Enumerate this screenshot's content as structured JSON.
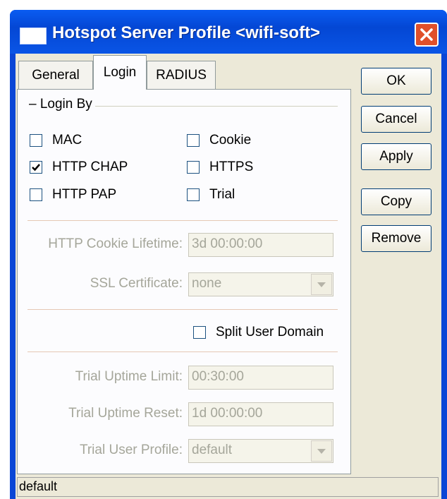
{
  "window": {
    "title": "Hotspot Server Profile <wifi-soft>"
  },
  "tabs": [
    {
      "label": "General",
      "active": false
    },
    {
      "label": "Login",
      "active": true
    },
    {
      "label": "RADIUS",
      "active": false
    }
  ],
  "login_by": {
    "title": "Login By",
    "options": [
      {
        "label": "MAC",
        "checked": false
      },
      {
        "label": "Cookie",
        "checked": false
      },
      {
        "label": "HTTP CHAP",
        "checked": true
      },
      {
        "label": "HTTPS",
        "checked": false
      },
      {
        "label": "HTTP PAP",
        "checked": false
      },
      {
        "label": "Trial",
        "checked": false
      }
    ]
  },
  "fields": {
    "cookie_lifetime": {
      "label": "HTTP Cookie Lifetime:",
      "value": "3d 00:00:00"
    },
    "ssl_certificate": {
      "label": "SSL Certificate:",
      "value": "none"
    },
    "split_user_domain": {
      "label": "Split User Domain",
      "checked": false
    },
    "trial_uptime_limit": {
      "label": "Trial Uptime Limit:",
      "value": "00:30:00"
    },
    "trial_uptime_reset": {
      "label": "Trial Uptime Reset:",
      "value": "1d 00:00:00"
    },
    "trial_user_profile": {
      "label": "Trial User Profile:",
      "value": "default"
    }
  },
  "buttons": {
    "ok": "OK",
    "cancel": "Cancel",
    "apply": "Apply",
    "copy": "Copy",
    "remove": "Remove"
  },
  "status": {
    "text": "default"
  },
  "icons": {
    "close": "close-icon",
    "check": "check-icon",
    "dropdown": "chevron-down-icon",
    "window": "window-icon"
  },
  "colors": {
    "titlebar": "#0447d4",
    "client_bg": "#ece9d8",
    "panel_bg": "#fcfcfe",
    "close": "#e0502a",
    "disabled_text": "#a5a69a"
  }
}
